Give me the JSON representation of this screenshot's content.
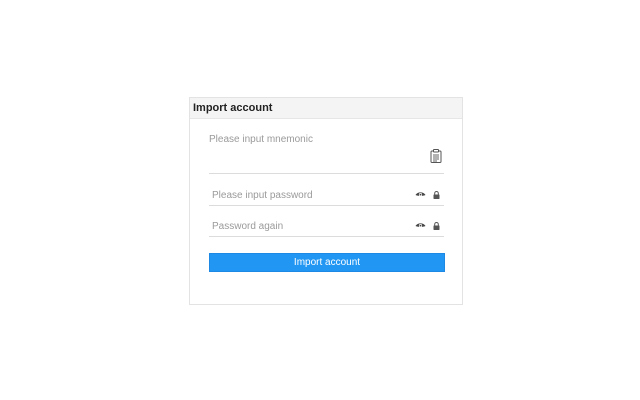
{
  "card": {
    "title": "Import account"
  },
  "mnemonic": {
    "placeholder": "Please input mnemonic",
    "value": "",
    "paste_icon": "clipboard-icon"
  },
  "password": {
    "placeholder": "Please input password",
    "value": "",
    "toggle_icon": "eye-icon",
    "lock_icon": "lock-icon"
  },
  "password_again": {
    "placeholder": "Password again",
    "value": "",
    "toggle_icon": "eye-icon",
    "lock_icon": "lock-icon"
  },
  "submit": {
    "label": "Import account"
  },
  "colors": {
    "accent": "#2196f3",
    "header_bg": "#f4f4f4",
    "placeholder": "#9a9a9a"
  }
}
